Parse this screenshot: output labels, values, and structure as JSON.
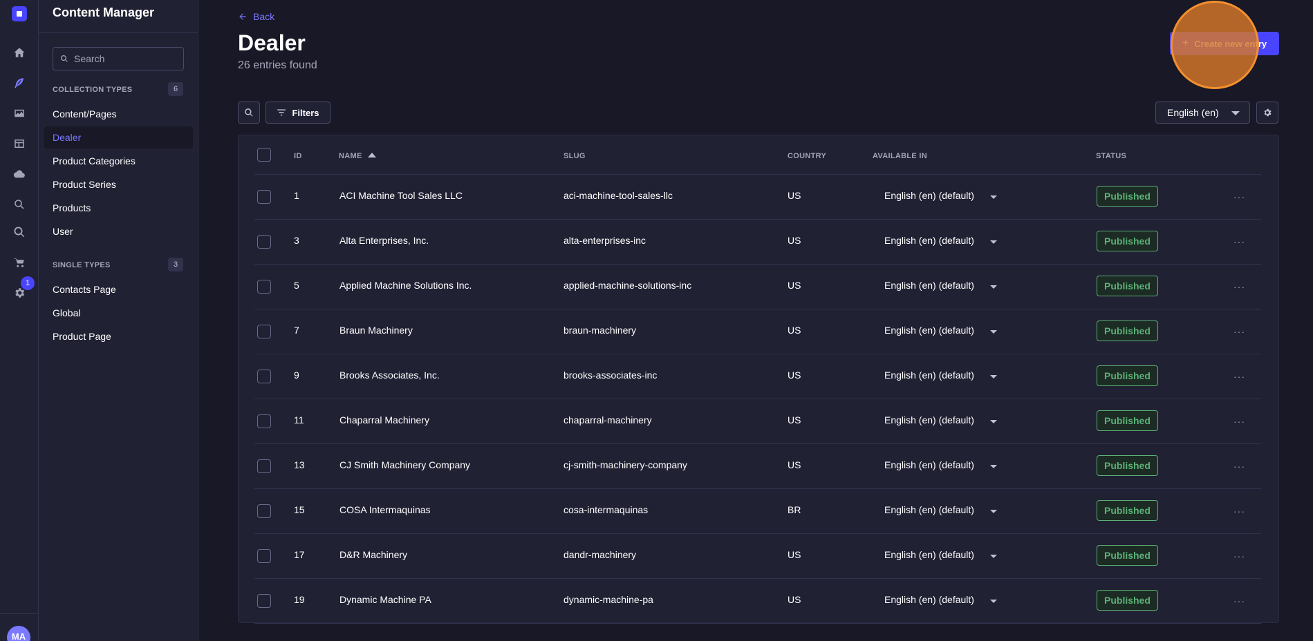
{
  "rail": {
    "icons": [
      "home-icon",
      "feather-icon",
      "media-icon",
      "layout-icon",
      "cloud-icon",
      "search-icon",
      "magnifier-icon",
      "cart-icon",
      "settings-icon"
    ],
    "settings_badge": "1",
    "avatar_initials": "MA"
  },
  "subnav": {
    "title": "Content Manager",
    "search_placeholder": "Search",
    "collection_label": "COLLECTION TYPES",
    "collection_count": "6",
    "collection_items": [
      "Content/Pages",
      "Dealer",
      "Product Categories",
      "Product Series",
      "Products",
      "User"
    ],
    "single_label": "SINGLE TYPES",
    "single_count": "3",
    "single_items": [
      "Contacts Page",
      "Global",
      "Product Page"
    ]
  },
  "header": {
    "back_label": "Back",
    "title": "Dealer",
    "subtitle": "26 entries found",
    "create_label": "Create new entry"
  },
  "toolbar": {
    "filters_label": "Filters",
    "locale": "English (en)"
  },
  "table": {
    "columns": [
      "ID",
      "NAME",
      "SLUG",
      "COUNTRY",
      "AVAILABLE IN",
      "STATUS"
    ],
    "rows": [
      {
        "id": "1",
        "name": "ACI Machine Tool Sales LLC",
        "slug": "aci-machine-tool-sales-llc",
        "country": "US",
        "available": "English (en) (default)",
        "status": "Published"
      },
      {
        "id": "3",
        "name": "Alta Enterprises, Inc.",
        "slug": "alta-enterprises-inc",
        "country": "US",
        "available": "English (en) (default)",
        "status": "Published"
      },
      {
        "id": "5",
        "name": "Applied Machine Solutions Inc.",
        "slug": "applied-machine-solutions-inc",
        "country": "US",
        "available": "English (en) (default)",
        "status": "Published"
      },
      {
        "id": "7",
        "name": "Braun Machinery",
        "slug": "braun-machinery",
        "country": "US",
        "available": "English (en) (default)",
        "status": "Published"
      },
      {
        "id": "9",
        "name": "Brooks Associates, Inc.",
        "slug": "brooks-associates-inc",
        "country": "US",
        "available": "English (en) (default)",
        "status": "Published"
      },
      {
        "id": "11",
        "name": "Chaparral Machinery",
        "slug": "chaparral-machinery",
        "country": "US",
        "available": "English (en) (default)",
        "status": "Published"
      },
      {
        "id": "13",
        "name": "CJ Smith Machinery Company",
        "slug": "cj-smith-machinery-company",
        "country": "US",
        "available": "English (en) (default)",
        "status": "Published"
      },
      {
        "id": "15",
        "name": "COSA Intermaquinas",
        "slug": "cosa-intermaquinas",
        "country": "BR",
        "available": "English (en) (default)",
        "status": "Published"
      },
      {
        "id": "17",
        "name": "D&R Machinery",
        "slug": "dandr-machinery",
        "country": "US",
        "available": "English (en) (default)",
        "status": "Published"
      },
      {
        "id": "19",
        "name": "Dynamic Machine PA",
        "slug": "dynamic-machine-pa",
        "country": "US",
        "available": "English (en) (default)",
        "status": "Published"
      }
    ]
  }
}
